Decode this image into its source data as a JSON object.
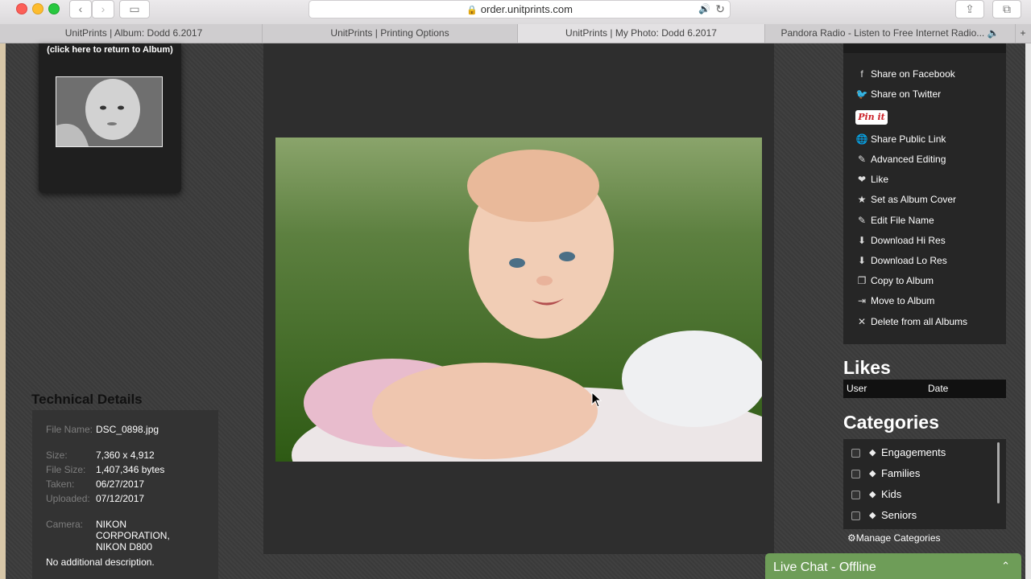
{
  "browser": {
    "address": "order.unitprints.com",
    "tabs": [
      "UnitPrints | Album: Dodd 6.2017",
      "UnitPrints | Printing Options",
      "UnitPrints | My Photo: Dodd 6.2017",
      "Pandora Radio - Listen to Free Internet Radio..."
    ]
  },
  "album": {
    "return_link": "(click here to return to Album)"
  },
  "technical": {
    "title": "Technical Details",
    "rows": [
      {
        "k": "File Name:",
        "v": "DSC_0898.jpg"
      },
      {
        "k": "Size:",
        "v": "7,360 x 4,912"
      },
      {
        "k": "File Size:",
        "v": "1,407,346 bytes"
      },
      {
        "k": "Taken:",
        "v": "06/27/2017"
      },
      {
        "k": "Uploaded:",
        "v": "07/12/2017"
      },
      {
        "k": "Camera:",
        "v": "NIKON CORPORATION, NIKON D800"
      }
    ],
    "description": "No additional description."
  },
  "share": {
    "facebook": "Share on Facebook",
    "twitter": "Share on Twitter",
    "pinit": "Pin it",
    "public_link": "Share Public Link",
    "advanced_editing": "Advanced Editing",
    "like": "Like",
    "album_cover": "Set as Album Cover",
    "edit_name": "Edit File Name",
    "download_hi": "Download Hi Res",
    "download_lo": "Download Lo Res",
    "copy": "Copy to Album",
    "move": "Move to Album",
    "delete": "Delete from all Albums"
  },
  "likes": {
    "title": "Likes",
    "col_user": "User",
    "col_date": "Date"
  },
  "categories": {
    "title": "Categories",
    "items": [
      "Engagements",
      "Families",
      "Kids",
      "Seniors"
    ],
    "manage": "Manage Categories"
  },
  "chat": {
    "label": "Live Chat - Offline"
  }
}
